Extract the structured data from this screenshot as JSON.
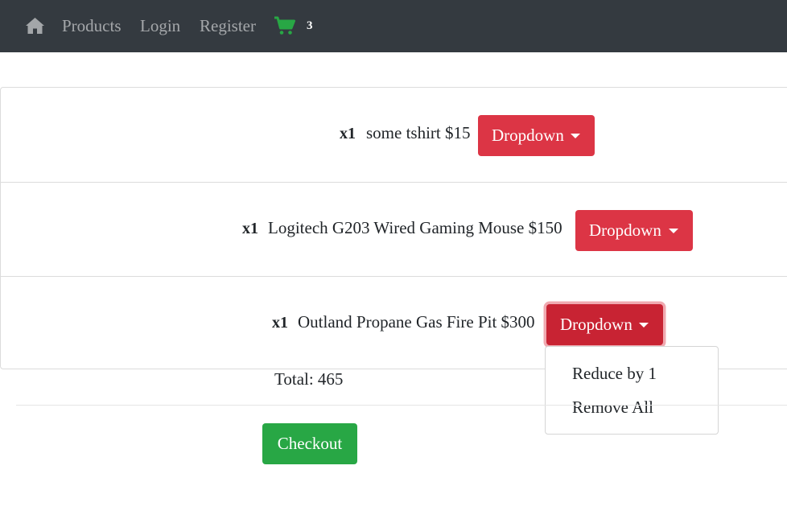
{
  "navbar": {
    "home_icon": "home-icon",
    "links": [
      "Products",
      "Login",
      "Register"
    ],
    "cart_icon": "shopping-cart-icon",
    "cart_count": "3",
    "cart_icon_color": "#28a745"
  },
  "cart": {
    "items": [
      {
        "qty": "x1",
        "text": "some tshirt $15",
        "button_label": "Dropdown"
      },
      {
        "qty": "x1",
        "text": "Logitech G203 Wired Gaming Mouse $150",
        "button_label": "Dropdown"
      },
      {
        "qty": "x1",
        "text": "Outland Propane Gas Fire Pit $300",
        "button_label": "Dropdown"
      }
    ],
    "open_dropdown": {
      "items": [
        "Reduce by 1",
        "Remove All"
      ]
    },
    "total_label": "Total: 465",
    "checkout_label": "Checkout"
  },
  "colors": {
    "navbar_bg": "#343a40",
    "danger": "#dc3545",
    "success": "#28a745"
  }
}
